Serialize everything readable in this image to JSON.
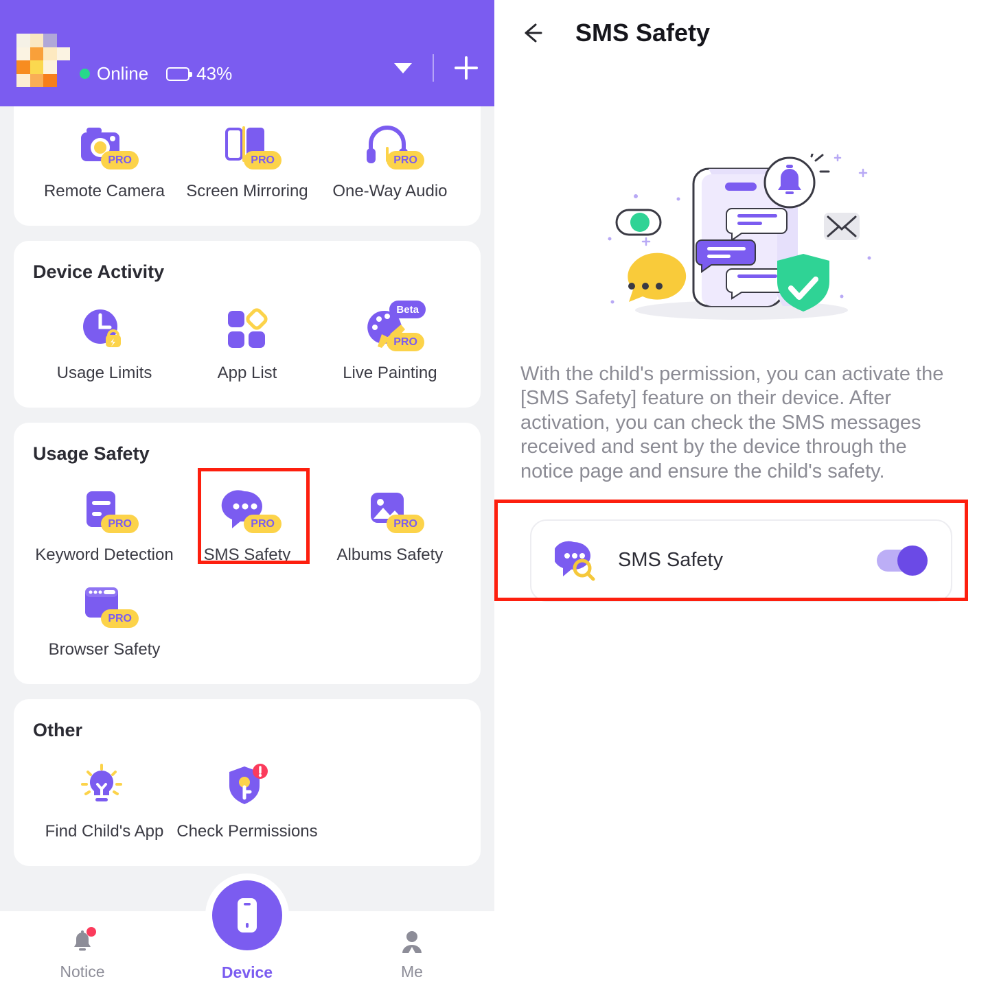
{
  "colors": {
    "brand_purple": "#7b5cf0",
    "badge_yellow": "#fcd34a",
    "online_green": "#27d98a",
    "alert_red": "#fb3b5c",
    "highlight_red": "#fd1f0e",
    "page_bg": "#f1f2f4"
  },
  "left": {
    "header": {
      "avatar_name": "avatar",
      "status_label": "Online",
      "battery_label": "43%",
      "battery_percent": 43,
      "dropdown_icon": "chevron-down-icon",
      "add_icon": "plus-icon"
    },
    "sections": [
      {
        "id": "remote",
        "title": "",
        "tiles": [
          {
            "label": "Remote Camera",
            "icon": "camera-icon",
            "badge": "PRO",
            "beta": null
          },
          {
            "label": "Screen Mirroring",
            "icon": "screen-mirroring-icon",
            "badge": "PRO",
            "beta": null
          },
          {
            "label": "One-Way Audio",
            "icon": "headphones-icon",
            "badge": "PRO",
            "beta": null
          }
        ]
      },
      {
        "id": "device-activity",
        "title": "Device Activity",
        "tiles": [
          {
            "label": "Usage Limits",
            "icon": "clock-lock-icon",
            "badge": null,
            "beta": null
          },
          {
            "label": "App List",
            "icon": "app-grid-icon",
            "badge": null,
            "beta": null
          },
          {
            "label": "Live Painting",
            "icon": "palette-brush-icon",
            "badge": "PRO",
            "beta": "Beta"
          }
        ]
      },
      {
        "id": "usage-safety",
        "title": "Usage Safety",
        "tiles": [
          {
            "label": "Keyword Detection",
            "icon": "document-lines-icon",
            "badge": "PRO",
            "beta": null
          },
          {
            "label": "SMS Safety",
            "icon": "chat-bubble-icon",
            "badge": "PRO",
            "beta": null
          },
          {
            "label": "Albums Safety",
            "icon": "photo-icon",
            "badge": "PRO",
            "beta": null
          },
          {
            "label": "Browser Safety",
            "icon": "browser-window-icon",
            "badge": "PRO",
            "beta": null
          }
        ]
      },
      {
        "id": "other",
        "title": "Other",
        "tiles": [
          {
            "label": "Find Child's App",
            "icon": "lightbulb-icon",
            "badge": null,
            "beta": null
          },
          {
            "label": "Check Permissions",
            "icon": "shield-key-icon",
            "badge": null,
            "beta": null
          }
        ]
      }
    ],
    "bottom_nav": [
      {
        "label": "Notice",
        "icon": "bell-icon",
        "active": false,
        "has_dot": true
      },
      {
        "label": "Device",
        "icon": "phone-icon",
        "active": true,
        "has_dot": false
      },
      {
        "label": "Me",
        "icon": "person-icon",
        "active": false,
        "has_dot": false
      }
    ]
  },
  "right": {
    "back_icon": "back-arrow-icon",
    "title": "SMS Safety",
    "illustration": "sms-safety-illustration",
    "description": "With the child's permission, you can activate the [SMS Safety] feature on their device. After activation, you can check the SMS messages received and sent by the device through the notice page and ensure the child's safety.",
    "toggle_row": {
      "icon": "chat-search-icon",
      "label": "SMS Safety",
      "state": "on"
    }
  }
}
